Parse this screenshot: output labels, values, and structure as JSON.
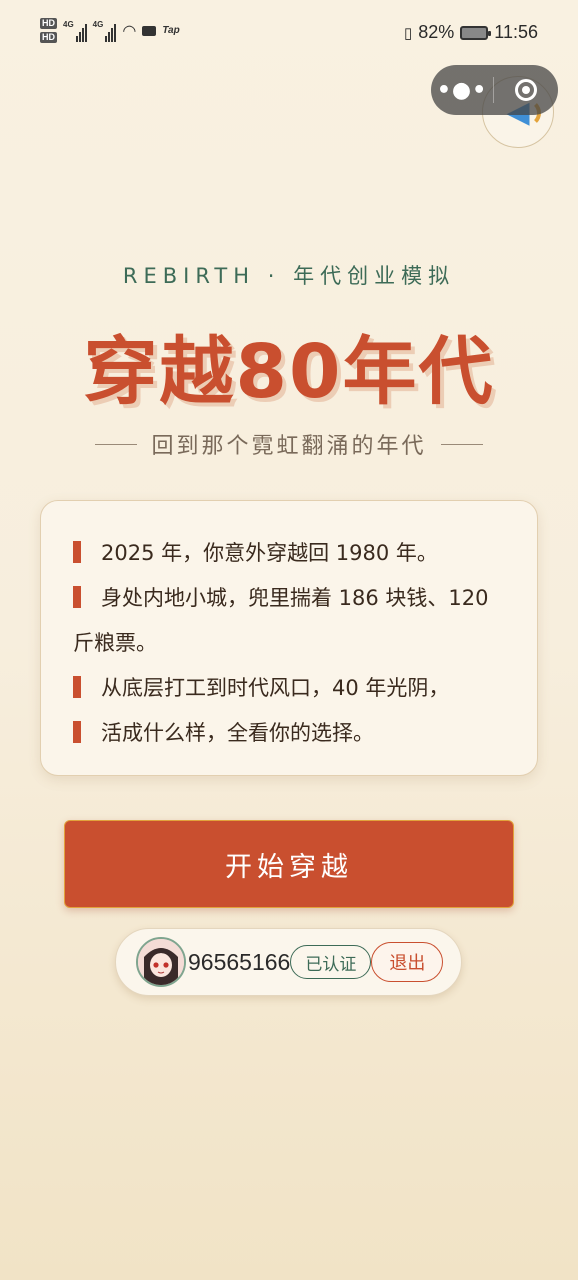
{
  "status_bar": {
    "hd_1": "HD",
    "hd_2": "HD",
    "net_1": "4G",
    "net_2": "4G",
    "tap": "Tap",
    "battery": "82%",
    "time": "11:56"
  },
  "capsule": {
    "more_icon": "more-dots-icon",
    "close_icon": "target-close-icon"
  },
  "music": {
    "icon": "speaker-icon"
  },
  "hero": {
    "tagline": "REBIRTH · 年代创业模拟",
    "title": "穿越80年代",
    "subtitle": "回到那个霓虹翻涌的年代"
  },
  "story": {
    "lines": [
      "2025 年，你意外穿越回 1980 年。",
      "身处内地小城，兜里揣着 186 块钱、120 斤粮票。",
      "从底层打工到时代风口，40 年光阴，",
      "活成什么样，全看你的选择。"
    ],
    "accent": "#c94f2f"
  },
  "start_button": {
    "label": "开始穿越"
  },
  "user": {
    "id": "96565166",
    "verified": "已认证",
    "logout": "退出"
  },
  "colors": {
    "accent": "#c94f2f",
    "green": "#3d6b57",
    "background": "#f9f1e1"
  }
}
